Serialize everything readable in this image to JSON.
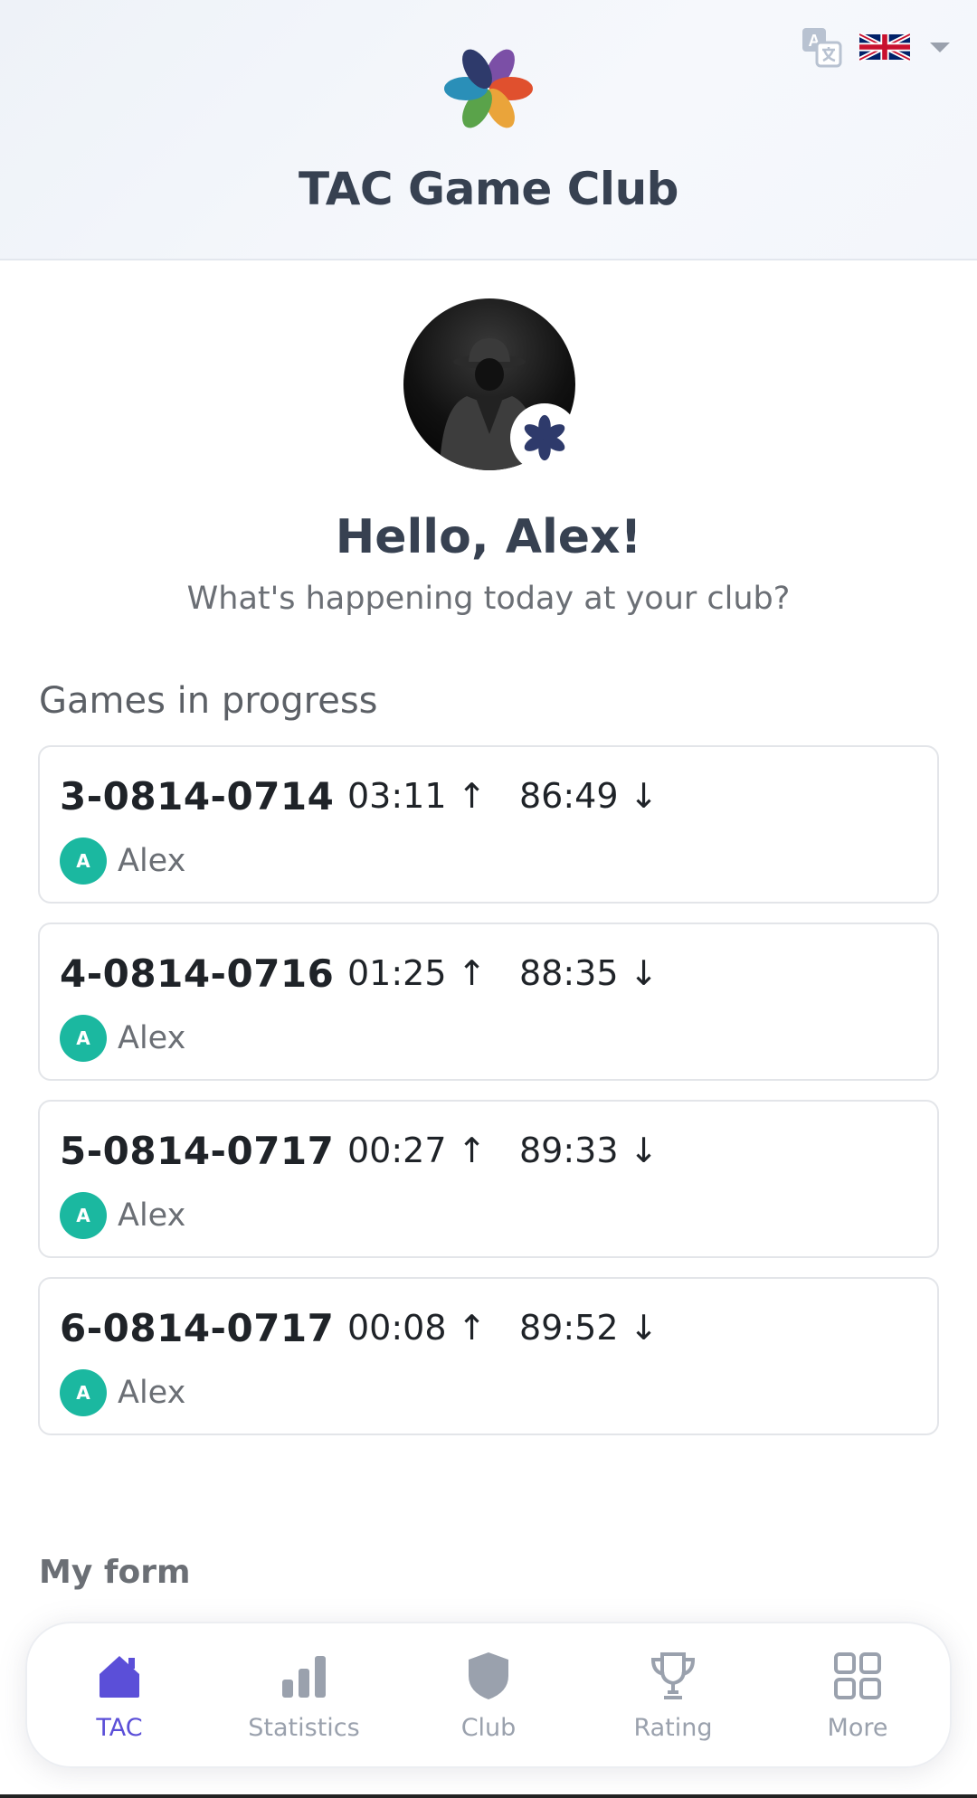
{
  "header": {
    "title": "TAC Game Club",
    "language": "English"
  },
  "profile": {
    "greeting": "Hello, Alex!",
    "subtitle": "What's happening today at your club?"
  },
  "games_section": {
    "title": "Games in progress",
    "games": [
      {
        "id": "3-0814-0714",
        "time_up": "03:11 ↑",
        "time_down": "86:49 ↓",
        "player_initial": "A",
        "player": "Alex"
      },
      {
        "id": "4-0814-0716",
        "time_up": "01:25 ↑",
        "time_down": "88:35 ↓",
        "player_initial": "A",
        "player": "Alex"
      },
      {
        "id": "5-0814-0717",
        "time_up": "00:27 ↑",
        "time_down": "89:33 ↓",
        "player_initial": "A",
        "player": "Alex"
      },
      {
        "id": "6-0814-0717",
        "time_up": "00:08 ↑",
        "time_down": "89:52 ↓",
        "player_initial": "A",
        "player": "Alex"
      }
    ]
  },
  "form_section": {
    "title": "My form"
  },
  "nav": {
    "items": [
      {
        "label": "TAC",
        "icon": "home-icon",
        "active": true
      },
      {
        "label": "Statistics",
        "icon": "bar-chart-icon"
      },
      {
        "label": "Club",
        "icon": "shield-icon"
      },
      {
        "label": "Rating",
        "icon": "trophy-icon"
      },
      {
        "label": "More",
        "icon": "grid-icon"
      }
    ]
  },
  "colors": {
    "accent": "#5b4fd8",
    "player_avatar": "#1bb8a0",
    "nav_inactive": "#9aa1ad"
  }
}
